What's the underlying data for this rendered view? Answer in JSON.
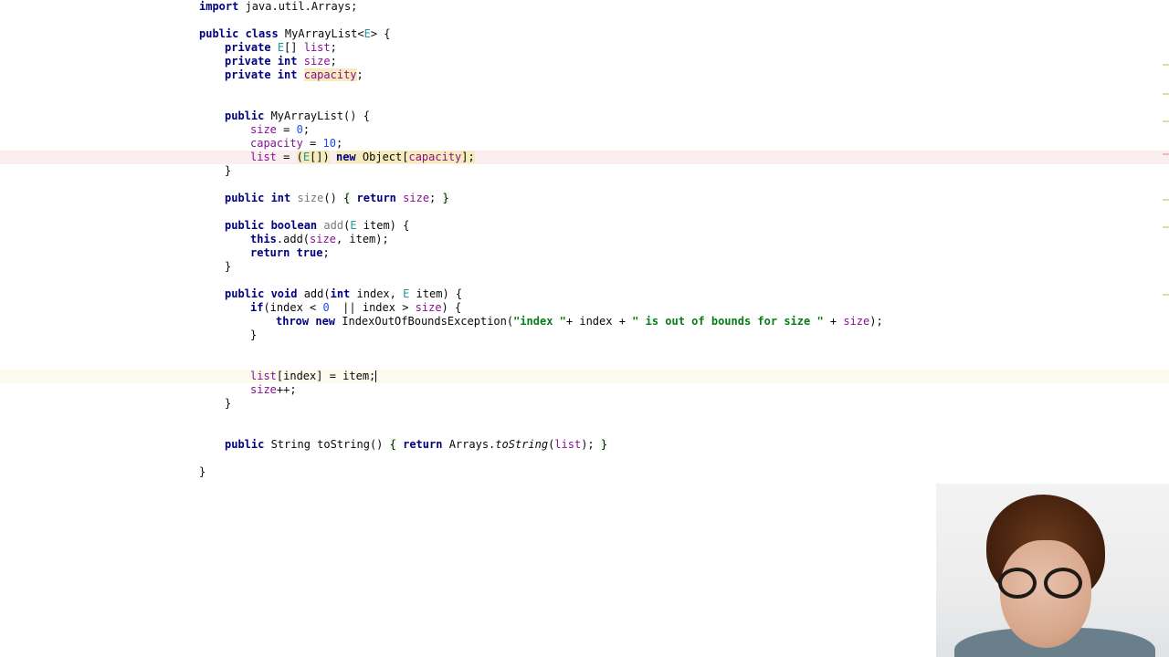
{
  "editor": {
    "lines": {
      "l1": [
        "import",
        " java.util.Arrays;"
      ],
      "l2_kw": "public class",
      "l2_rest_a": " MyArrayList<",
      "l2_tp": "E",
      "l2_rest_b": "> {",
      "l3_kw": "private",
      "l3_tp": "E",
      "l3_rest": "[] ",
      "l3_field": "list",
      "l3_end": ";",
      "l4_kw": "private int",
      "l4_field": "size",
      "l4_end": ";",
      "l5_kw": "private int",
      "l5_field": "capacity",
      "l5_end": ";",
      "l6_kw": "public",
      "l6_rest": " MyArrayList() {",
      "l7_field": "size",
      "l7_mid": " = ",
      "l7_num": "0",
      "l7_end": ";",
      "l8_field": "capacity",
      "l8_mid": " = ",
      "l8_num": "10",
      "l8_end": ";",
      "l9_field": "list",
      "l9_mid": " = ",
      "l9_open": "(",
      "l9_tp": "E",
      "l9_close": "[])",
      "l9_sp": " ",
      "l9_kw": "new",
      "l9_obj": " Object[",
      "l9_field2": "capacity",
      "l9_end": "];",
      "brace_close": "}",
      "l10_kw": "public int",
      "l10_sp": " ",
      "l10_name": "size",
      "l10_rest": "() ",
      "l10_b1": "{",
      "l10_sp2": " ",
      "l10_ret": "return",
      "l10_sp3": " ",
      "l10_field": "size",
      "l10_semi": "; ",
      "l10_b2": "}",
      "l11_kw": "public boolean",
      "l11_sp": " ",
      "l11_name": "add",
      "l11_open": "(",
      "l11_tp": "E",
      "l11_rest": " item) {",
      "l12_kw": "this",
      "l12_rest_a": ".add(",
      "l12_field": "size",
      "l12_rest_b": ", item);",
      "l13_kw": "return true",
      "l13_end": ";",
      "l14_kw": "public void",
      "l14_rest_a": " add(",
      "l14_kw2": "int",
      "l14_rest_b": " index, ",
      "l14_tp": "E",
      "l14_rest_c": " item) {",
      "l15_kw": "if",
      "l15_rest_a": "(index < ",
      "l15_num": "0",
      "l15_rest_b": "  || index > ",
      "l15_field": "size",
      "l15_rest_c": ") {",
      "l16_kw": "throw new",
      "l16_rest_a": " IndexOutOfBoundsException(",
      "l16_str1": "\"index \"",
      "l16_rest_b": "+ index + ",
      "l16_str2": "\" is out of bounds for size \"",
      "l16_rest_c": " + ",
      "l16_field": "size",
      "l16_end": ");",
      "l17_field": "list",
      "l17_rest": "[index] = item;",
      "l18_field": "size",
      "l18_rest": "++;",
      "l19_kw": "public",
      "l19_rest_a": " String toString() ",
      "l19_b1": "{",
      "l19_sp": " ",
      "l19_ret": "return",
      "l19_rest_b": " Arrays.",
      "l19_ital": "toString",
      "l19_open": "(",
      "l19_field": "list",
      "l19_end": "); ",
      "l19_b2": "}"
    }
  }
}
